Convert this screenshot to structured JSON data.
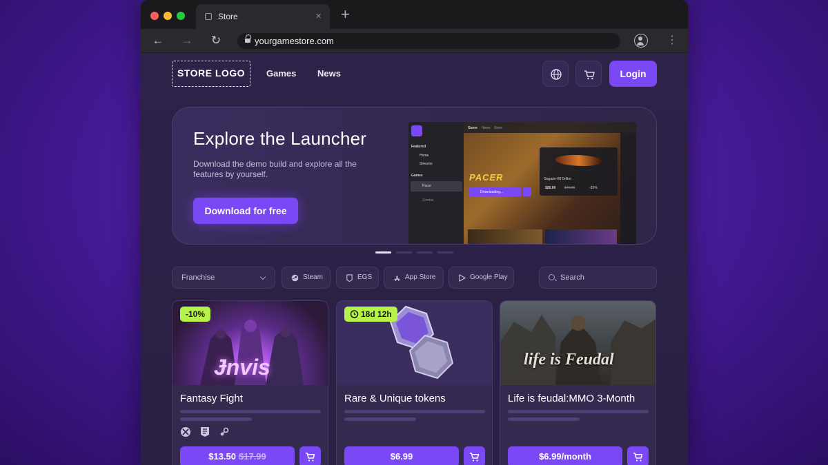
{
  "browser": {
    "tab_title": "Store",
    "url": "yourgamestore.com"
  },
  "header": {
    "logo": "STORE LOGO",
    "nav": [
      "Games",
      "News"
    ],
    "login_label": "Login"
  },
  "hero": {
    "title": "Explore the Launcher",
    "subtitle": "Download the demo build and explore all the features by yourself.",
    "cta": "Download for free",
    "screenshot": {
      "tabs": [
        "Game",
        "News",
        "Store"
      ],
      "featured_heading": "Featured",
      "featured_items": [
        "Home",
        "Streams"
      ],
      "games_heading": "Games",
      "games_items": [
        "Pacer",
        "Zombie"
      ],
      "game_title": "PACER",
      "download_label": "Downloading...",
      "card_title": "Gagarin-68 Drifter",
      "card_price": "$26.00",
      "card_old_price": "$40.00",
      "card_discount": "-35%"
    },
    "pager": {
      "total": 4,
      "active": 1
    }
  },
  "filters": {
    "franchise": "Franchise",
    "chips": [
      "Steam",
      "EGS",
      "App Store",
      "Google Play"
    ],
    "search_placeholder": "Search"
  },
  "products": [
    {
      "title": "Fantasy Fight",
      "badge": "-10%",
      "price": "$13.50",
      "old_price": "$17.99",
      "art_text": "Ɉnvis",
      "platforms": [
        "xbox-icon",
        "epic-icon",
        "steam-icon"
      ]
    },
    {
      "title": "Rare & Unique tokens",
      "badge": "18d 12h",
      "price": "$6.99"
    },
    {
      "title": "Life is feudal:MMO 3-Month",
      "badge": "",
      "price": "$6.99/month",
      "art_text": "life is Feudal"
    }
  ],
  "colors": {
    "accent": "#7a48f5",
    "badge": "#b6f24a",
    "page_bg": "#2b2145"
  }
}
